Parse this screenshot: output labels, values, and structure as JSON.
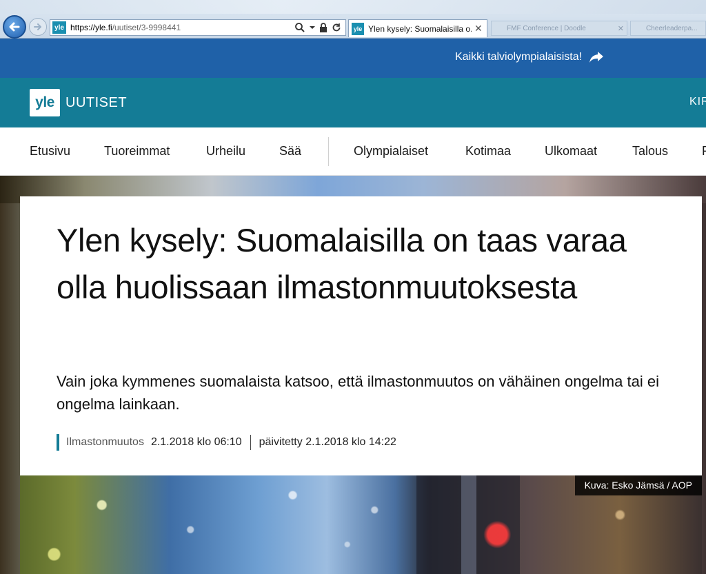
{
  "browser": {
    "url_host": "https://yle.fi",
    "url_path": "/uutiset/3-9998441",
    "favicon_text": "yle",
    "active_tab_title": "Ylen kysely: Suomalaisilla o...",
    "tab2_title": "FMF Conference | Doodle",
    "tab3_title": "Cheerleaderpa..."
  },
  "promo": {
    "link_text": "Kaikki talviolympialaisista!"
  },
  "header": {
    "logo_text": "yle",
    "brand": "UUTISET",
    "right_text": "KIR"
  },
  "nav": {
    "items": [
      "Etusivu",
      "Tuoreimmat",
      "Urheilu",
      "Sää",
      "Olympialaiset",
      "Kotimaa",
      "Ulkomaat",
      "Talous",
      "P"
    ]
  },
  "article": {
    "headline": "Ylen kysely: Suomalaisilla on taas varaa olla huolissaan ilmastonmuutoksesta",
    "lead": "Vain joka kymmenes suomalaista katsoo, että ilmastonmuutos on vähäinen ongelma tai ei ongelma lainkaan.",
    "topic": "Ilmastonmuutos",
    "published": "2.1.2018 klo 06:10",
    "updated": "päivitetty 2.1.2018 klo 14:22"
  },
  "image": {
    "caption": "Kuva: Esko Jämsä / AOP"
  },
  "colors": {
    "promo_bg": "#1f61a8",
    "yle_teal": "#147c96"
  }
}
